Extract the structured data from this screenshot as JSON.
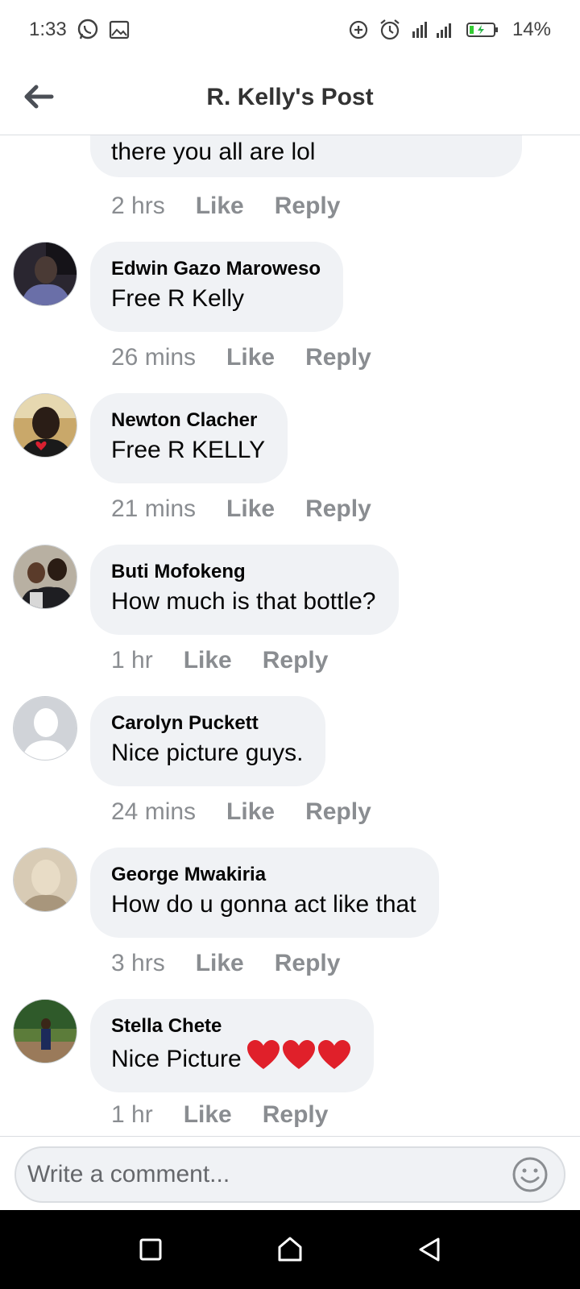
{
  "status_bar": {
    "time": "1:33",
    "battery": "14%",
    "icons": [
      "whatsapp-icon",
      "gallery-icon",
      "data-saver-icon",
      "alarm-icon",
      "signal-icon",
      "battery-charging-icon"
    ]
  },
  "header": {
    "title": "R. Kelly's Post",
    "back_icon": "arrow-left-icon"
  },
  "comments": [
    {
      "author": "",
      "text": "there you all are lol",
      "time": "2 hrs",
      "like": "Like",
      "reply": "Reply"
    },
    {
      "author": "Edwin Gazo Maroweso",
      "text": "Free R Kelly",
      "time": "26 mins",
      "like": "Like",
      "reply": "Reply"
    },
    {
      "author": "Newton Clacher",
      "text": "Free R KELLY",
      "time": "21 mins",
      "like": "Like",
      "reply": "Reply"
    },
    {
      "author": "Buti Mofokeng",
      "text": "How much is that bottle?",
      "time": "1 hr",
      "like": "Like",
      "reply": "Reply"
    },
    {
      "author": "Carolyn Puckett",
      "text": "Nice picture guys.",
      "time": "24 mins",
      "like": "Like",
      "reply": "Reply"
    },
    {
      "author": "George Mwakiria",
      "text": "How do u gonna act like that",
      "time": "3 hrs",
      "like": "Like",
      "reply": "Reply"
    },
    {
      "author": "Stella Chete",
      "text": "Nice Picture",
      "time": "1 hr",
      "like": "Like",
      "reply": "Reply"
    }
  ],
  "composer": {
    "placeholder": "Write a comment...",
    "emoji_icon": "smiley-icon"
  },
  "colors": {
    "bubble": "#f0f2f5",
    "meta": "#8a8d91",
    "heart": "#e0202a"
  }
}
